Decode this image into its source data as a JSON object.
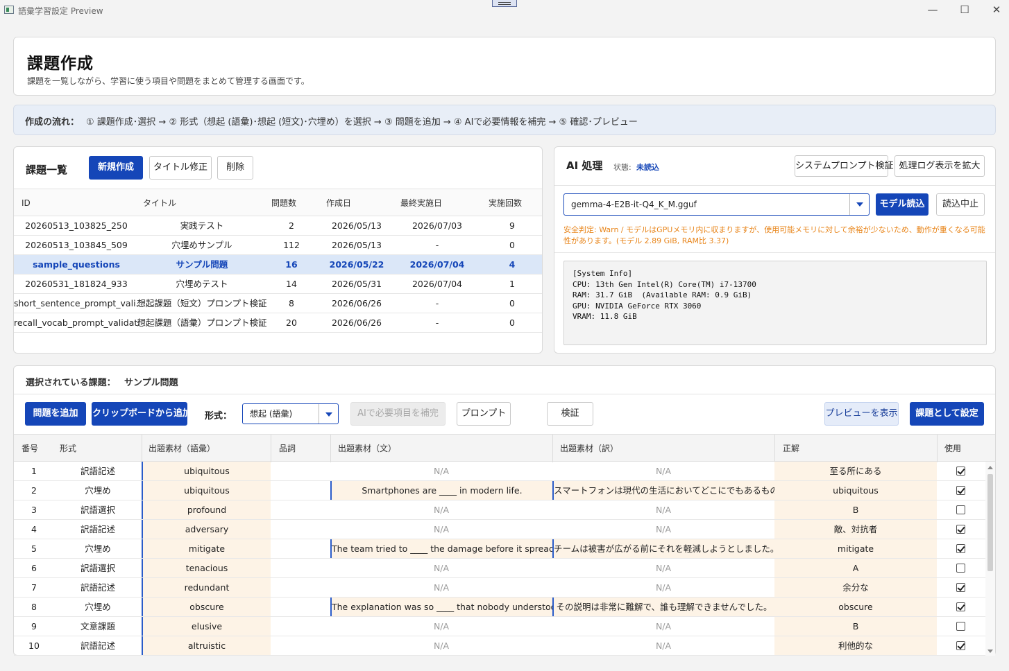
{
  "window": {
    "title": "語彙学習設定 Preview",
    "minimize": "—",
    "maximize": "☐",
    "close": "✕"
  },
  "header": {
    "title": "課題作成",
    "subtitle": "課題を一覧しながら、学習に使う項目や問題をまとめて管理する画面です。"
  },
  "flow": {
    "label": "作成の流れ：",
    "steps": "① 課題作成･選択 → ② 形式（想起 (語彙)･想起 (短文)･穴埋め）を選択 → ③ 問題を追加 → ④ AIで必要情報を補完 → ⑤ 確認･プレビュー"
  },
  "task_list": {
    "title": "課題一覧",
    "buttons": {
      "new": "新規作成",
      "rename": "タイトル修正",
      "delete": "削除"
    },
    "columns": {
      "id": "ID",
      "title": "タイトル",
      "count": "問題数",
      "created": "作成日",
      "last": "最終実施日",
      "runs": "実施回数"
    },
    "rows": [
      {
        "id": "20260513_103825_250",
        "title": "実践テスト",
        "count": "2",
        "created": "2026/05/13",
        "last": "2026/07/03",
        "runs": "9"
      },
      {
        "id": "20260513_103845_509",
        "title": "穴埋めサンプル",
        "count": "112",
        "created": "2026/05/13",
        "last": "-",
        "runs": "0"
      },
      {
        "id": "sample_questions",
        "title": "サンプル問題",
        "count": "16",
        "created": "2026/05/22",
        "last": "2026/07/04",
        "runs": "4"
      },
      {
        "id": "20260531_181824_933",
        "title": "穴埋めテスト",
        "count": "14",
        "created": "2026/05/31",
        "last": "2026/07/04",
        "runs": "1"
      },
      {
        "id": "short_sentence_prompt_vali...",
        "title": "想起課題（短文）プロンプト検証",
        "count": "8",
        "created": "2026/06/26",
        "last": "-",
        "runs": "0"
      },
      {
        "id": "recall_vocab_prompt_validati...",
        "title": "想起課題（語彙）プロンプト検証",
        "count": "20",
        "created": "2026/06/26",
        "last": "-",
        "runs": "0"
      }
    ]
  },
  "ai": {
    "title": "AI 処理",
    "status_label": "状態:",
    "status_value": "未読込",
    "buttons": {
      "system_prompt": "システムプロンプト検証",
      "log": "処理ログ表示を拡大",
      "load": "モデル読込",
      "stop": "読込中止"
    },
    "model": "gemma-4-E2B-it-Q4_K_M.gguf",
    "warning": "安全判定: Warn / モデルはGPUメモリ内に収まりますが、使用可能メモリに対して余裕が少ないため、動作が重くなる可能性があります。(モデル 2.89 GiB, RAM比 3.37)",
    "sysinfo": "[System Info]\nCPU: 13th Gen Intel(R) Core(TM) i7-13700\nRAM: 31.7 GiB  (Available RAM: 0.9 GiB)\nGPU: NVIDIA GeForce RTX 3060\nVRAM: 11.8 GiB"
  },
  "selected": {
    "label": "選択されている課題：",
    "name": "サンプル問題",
    "buttons": {
      "add": "問題を追加",
      "clipboard": "クリップボードから追加",
      "ai_fill": "AIで必要項目を補完",
      "prompt": "プロンプト",
      "verify": "検証",
      "preview": "プレビューを表示",
      "set": "課題として設定"
    },
    "format_label": "形式：",
    "format_value": "想起 (語彙)",
    "columns": {
      "no": "番号",
      "type": "形式",
      "word": "出題素材（語彙）",
      "pos": "品詞",
      "sentence": "出題素材（文）",
      "translation": "出題素材（訳）",
      "answer": "正解",
      "use": "使用"
    },
    "rows": [
      {
        "no": "1",
        "type": "訳語記述",
        "word": "ubiquitous",
        "pos": "",
        "sentence": "N/A",
        "translation": "N/A",
        "answer": "至る所にある",
        "use": true
      },
      {
        "no": "2",
        "type": "穴埋め",
        "word": "ubiquitous",
        "pos": "",
        "sentence": "Smartphones are ____ in modern life.",
        "translation": "スマートフォンは現代の生活においてどこにでもあるものです。",
        "answer": "ubiquitous",
        "use": true
      },
      {
        "no": "3",
        "type": "訳語選択",
        "word": "profound",
        "pos": "",
        "sentence": "N/A",
        "translation": "N/A",
        "answer": "B",
        "use": false
      },
      {
        "no": "4",
        "type": "訳語記述",
        "word": "adversary",
        "pos": "",
        "sentence": "N/A",
        "translation": "N/A",
        "answer": "敵、対抗者",
        "use": true
      },
      {
        "no": "5",
        "type": "穴埋め",
        "word": "mitigate",
        "pos": "",
        "sentence": "The team tried to ____ the damage before it spread.",
        "translation": "チームは被害が広がる前にそれを軽減しようとしました。",
        "answer": "mitigate",
        "use": true
      },
      {
        "no": "6",
        "type": "訳語選択",
        "word": "tenacious",
        "pos": "",
        "sentence": "N/A",
        "translation": "N/A",
        "answer": "A",
        "use": false
      },
      {
        "no": "7",
        "type": "訳語記述",
        "word": "redundant",
        "pos": "",
        "sentence": "N/A",
        "translation": "N/A",
        "answer": "余分な",
        "use": true
      },
      {
        "no": "8",
        "type": "穴埋め",
        "word": "obscure",
        "pos": "",
        "sentence": "The explanation was so ____ that nobody understood...",
        "translation": "その説明は非常に難解で、誰も理解できませんでした。",
        "answer": "obscure",
        "use": true
      },
      {
        "no": "9",
        "type": "文意課題",
        "word": "elusive",
        "pos": "",
        "sentence": "N/A",
        "translation": "N/A",
        "answer": "B",
        "use": false
      },
      {
        "no": "10",
        "type": "訳語記述",
        "word": "altruistic",
        "pos": "",
        "sentence": "N/A",
        "translation": "N/A",
        "answer": "利他的な",
        "use": true
      }
    ]
  },
  "colors": {
    "primary": "#1546b8",
    "selected_row": "#dbe7f8",
    "highlight_cell": "#fdf3e6",
    "warning": "#e8851a"
  }
}
